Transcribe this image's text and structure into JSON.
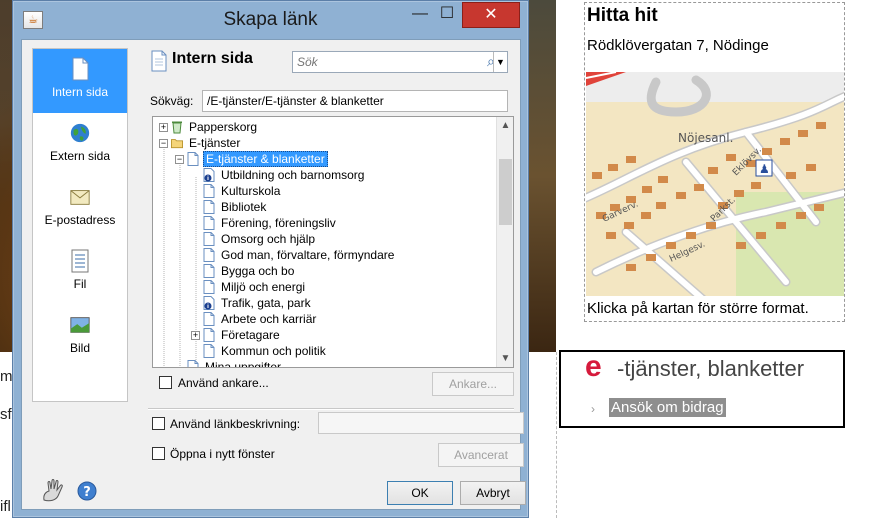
{
  "background": {
    "left_text_1": "m",
    "left_text_2": "sf",
    "left_text_3": "ifl",
    "map": {
      "title": "Hitta hit",
      "address": "Rödklövergatan 7, Nödinge",
      "caption": "Klicka på kartan för större format.",
      "street_labels": [
        "Nöjesanl.",
        "Garverv.",
        "Eklövsv.",
        "Parkst.",
        "Helgesv."
      ]
    },
    "eservices": {
      "logo_letter": "e",
      "title": "-tjänster, blanketter",
      "link": "Ansök om bidrag",
      "accent": "#d61a3c"
    }
  },
  "dialog": {
    "title": "Skapa länk",
    "window_buttons": {
      "minimize": "—",
      "maximize": "☐",
      "close": "✕"
    },
    "nav": [
      {
        "label": "Intern sida",
        "icon": "page-icon",
        "selected": true
      },
      {
        "label": "Extern sida",
        "icon": "globe-icon",
        "selected": false
      },
      {
        "label": "E-postadress",
        "icon": "envelope-icon",
        "selected": false
      },
      {
        "label": "Fil",
        "icon": "file-icon",
        "selected": false
      },
      {
        "label": "Bild",
        "icon": "image-icon",
        "selected": false
      }
    ],
    "header_title": "Intern sida",
    "search_placeholder": "Sök",
    "path_label": "Sökväg:",
    "path_value": "/E-tjänster/E-tjänster & blanketter",
    "tree": [
      {
        "label": "Papperskorg",
        "level": 0,
        "expander": "+",
        "icon": "recycle-bin-icon"
      },
      {
        "label": "E-tjänster",
        "level": 0,
        "expander": "−",
        "icon": "folder-icon"
      },
      {
        "label": "E-tjänster & blanketter",
        "level": 1,
        "expander": "−",
        "icon": "page-icon",
        "selected": true
      },
      {
        "label": "Utbildning och barnomsorg",
        "level": 2,
        "icon": "info-page-icon"
      },
      {
        "label": "Kulturskola",
        "level": 2,
        "icon": "page-icon"
      },
      {
        "label": "Bibliotek",
        "level": 2,
        "icon": "page-icon"
      },
      {
        "label": "Förening, föreningsliv",
        "level": 2,
        "icon": "page-icon"
      },
      {
        "label": "Omsorg och hjälp",
        "level": 2,
        "icon": "page-icon"
      },
      {
        "label": "God man, förvaltare, förmyndare",
        "level": 2,
        "icon": "page-icon"
      },
      {
        "label": "Bygga och bo",
        "level": 2,
        "icon": "page-icon"
      },
      {
        "label": "Miljö och energi",
        "level": 2,
        "icon": "page-icon"
      },
      {
        "label": "Trafik, gata, park",
        "level": 2,
        "icon": "info-page-icon"
      },
      {
        "label": "Arbete och karriär",
        "level": 2,
        "icon": "page-icon"
      },
      {
        "label": "Företagare",
        "level": 2,
        "expander": "+",
        "icon": "page-icon"
      },
      {
        "label": "Kommun och politik",
        "level": 2,
        "icon": "page-icon"
      },
      {
        "label": "Mina uppgifter",
        "level": 1,
        "icon": "page-icon"
      }
    ],
    "use_anchor_label": "Använd ankare...",
    "anchor_button": "Ankare...",
    "use_link_desc_label": "Använd länkbeskrivning:",
    "open_new_window_label": "Öppna i nytt fönster",
    "advanced_button": "Avancerat",
    "ok_button": "OK",
    "cancel_button": "Avbryt"
  }
}
